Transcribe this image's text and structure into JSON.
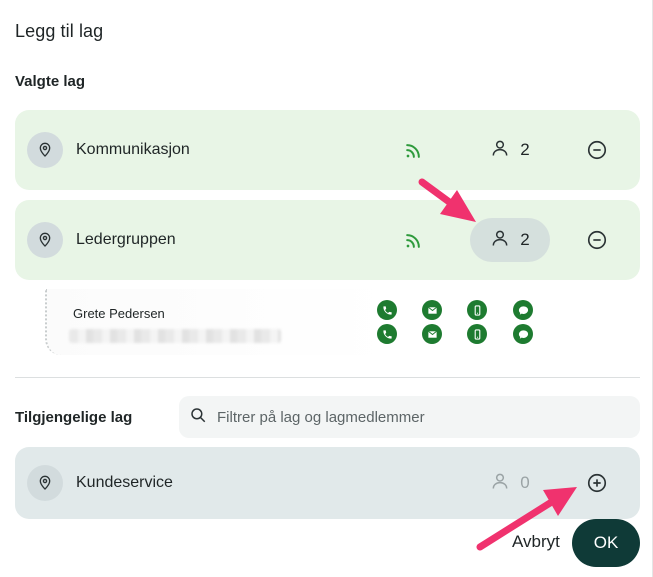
{
  "dialog": {
    "title": "Legg til lag",
    "selected_label": "Valgte lag",
    "available_label": "Tilgjengelige lag",
    "search_placeholder": "Filtrer på lag og lagmedlemmer",
    "cancel_label": "Avbryt",
    "ok_label": "OK"
  },
  "selected_teams": [
    {
      "name": "Kommunikasjon",
      "member_count": "2"
    },
    {
      "name": "Ledergruppen",
      "member_count": "2"
    }
  ],
  "expanded_members": [
    {
      "name": "Grete Pedersen"
    }
  ],
  "available_teams": [
    {
      "name": "Kundeservice",
      "member_count": "0"
    }
  ],
  "colors": {
    "selected_row": "#e8f5e6",
    "available_row": "#e1e9ea",
    "accent_green": "#1e7b30",
    "ok_button": "#0f3a37",
    "annotation_arrow": "#f0326e"
  },
  "icons": {
    "pin": "location-pin-icon",
    "rss": "rss-feed-icon",
    "person": "person-icon",
    "remove": "minus-circle-icon",
    "add": "plus-circle-icon",
    "search": "search-icon",
    "contacts": [
      "phone-icon",
      "email-icon",
      "mobile-icon",
      "chat-icon"
    ]
  }
}
